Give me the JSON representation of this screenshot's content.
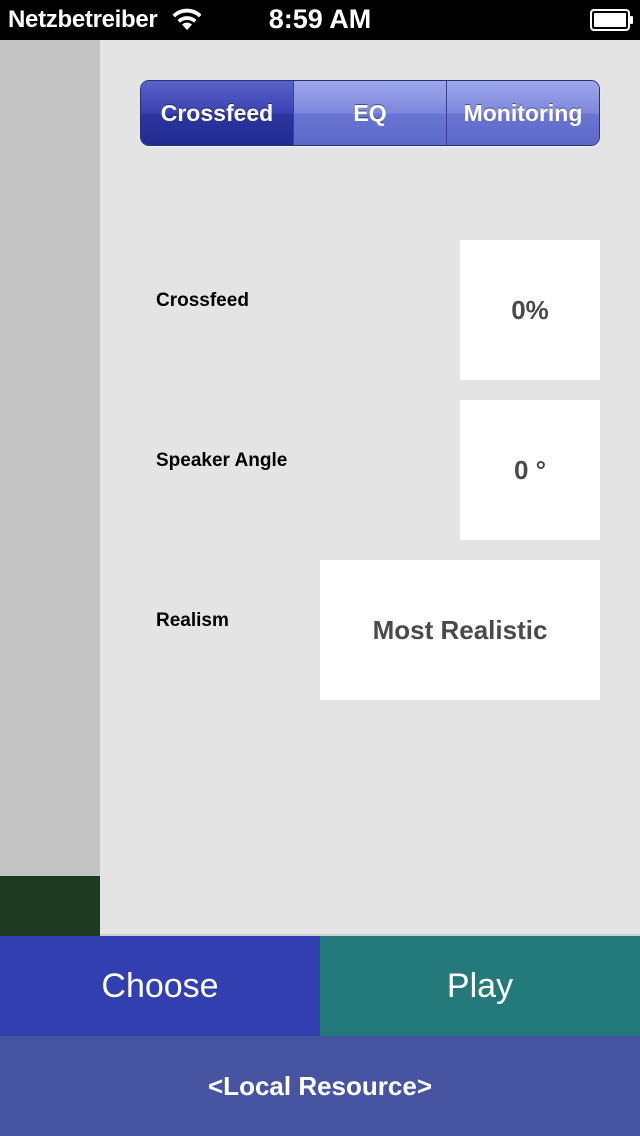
{
  "status_bar": {
    "carrier": "Netzbetreiber",
    "time": "8:59 AM",
    "wifi_icon": "wifi-icon",
    "battery_icon": "battery-icon"
  },
  "tabs": [
    {
      "label": "Crossfeed",
      "selected": true
    },
    {
      "label": "EQ",
      "selected": false
    },
    {
      "label": "Monitoring",
      "selected": false
    }
  ],
  "settings": {
    "crossfeed": {
      "label": "Crossfeed",
      "value": "0%"
    },
    "speaker_angle": {
      "label": "Speaker Angle",
      "value": "0 °"
    },
    "realism": {
      "label": "Realism",
      "value": "Most Realistic"
    }
  },
  "buttons": {
    "choose": "Choose",
    "play": "Play"
  },
  "resource": {
    "label": "<Local Resource>"
  },
  "colors": {
    "choose_bg": "#323fb0",
    "play_bg": "#247a7a",
    "resource_bg": "#4654a2",
    "segment_selected": "#2c35a0"
  }
}
